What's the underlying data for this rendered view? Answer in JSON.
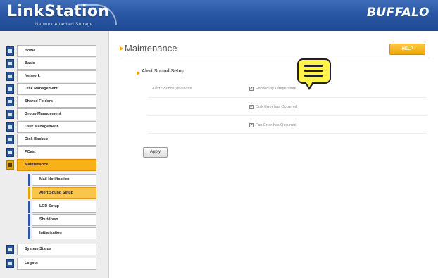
{
  "header": {
    "brand_title": "LinkStation",
    "brand_subtitle": "Network Attached Storage",
    "vendor_logo": "BUFFALO",
    "colors": {
      "header_blue": "#2a57a3",
      "accent_orange": "#f7b21a"
    }
  },
  "sidebar": {
    "items": [
      {
        "label": "Home",
        "icon": "home-icon",
        "active": false
      },
      {
        "label": "Basic",
        "icon": "basic-icon",
        "active": false
      },
      {
        "label": "Network",
        "icon": "network-icon",
        "active": false
      },
      {
        "label": "Disk Management",
        "icon": "disk-icon",
        "active": false
      },
      {
        "label": "Shared Folders",
        "icon": "folder-icon",
        "active": false
      },
      {
        "label": "Group Management",
        "icon": "group-icon",
        "active": false
      },
      {
        "label": "User Management",
        "icon": "user-icon",
        "active": false
      },
      {
        "label": "Disk Backup",
        "icon": "backup-icon",
        "active": false
      },
      {
        "label": "PCast",
        "icon": "pcast-icon",
        "active": false
      },
      {
        "label": "Maintenance",
        "icon": "maintenance-icon",
        "active": true
      }
    ],
    "sub_items": [
      {
        "label": "Mail Notification",
        "selected": false
      },
      {
        "label": "Alert Sound Setup",
        "selected": true
      },
      {
        "label": "LCD Setup",
        "selected": false
      },
      {
        "label": "Shutdown",
        "selected": false
      },
      {
        "label": "Initialization",
        "selected": false
      }
    ],
    "bottom_items": [
      {
        "label": "System Status",
        "icon": "status-icon"
      },
      {
        "label": "Logout",
        "icon": "logout-icon"
      }
    ]
  },
  "main": {
    "page_title": "Maintenance",
    "help_label": "HELP",
    "section_title": "Alert Sound Setup",
    "setting_label": "Alert Sound Conditions",
    "options": [
      {
        "label": "Exceeding Temperature",
        "checked": true
      },
      {
        "label": "Disk Error has Occurred",
        "checked": true
      },
      {
        "label": "Fan Error has Occurred",
        "checked": true
      }
    ],
    "apply_label": "Apply",
    "check_glyph": "✔"
  },
  "callout": {
    "icon": "speech-bubble-icon",
    "color": "#fff24a"
  }
}
